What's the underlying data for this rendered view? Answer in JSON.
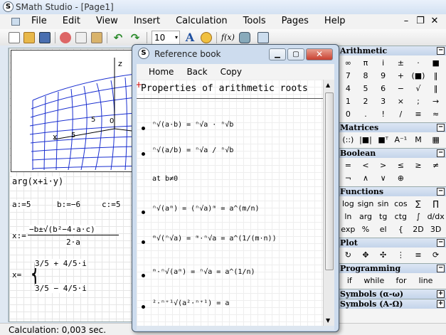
{
  "window": {
    "title": "SMath Studio - [Page1]"
  },
  "menu": [
    "File",
    "Edit",
    "View",
    "Insert",
    "Calculation",
    "Tools",
    "Pages",
    "Help"
  ],
  "toolbar": {
    "font_size": "10",
    "font_size_arrow": "▾",
    "text_icon": "A",
    "func_icon": "f(x)"
  },
  "worksheet": {
    "plot_axis_label_z": "z",
    "plot_axis_label_x": "x",
    "plot_tick_0": "0",
    "plot_tick_5": "5",
    "arg": "arg(x+i·y)",
    "assign_a": "a:=5",
    "assign_b": "b:=−6",
    "assign_c": "c:=5",
    "quad_lhs": "x:=",
    "quad_num": "−b±√(b²−4·a·c)",
    "quad_den": "2·a",
    "result_lhs": "x=",
    "result_1": "3/5 + 4/5·i",
    "result_2": "3/5 − 4/5·i"
  },
  "status": "Calculation: 0,003 sec.",
  "refbook": {
    "title": "Reference book",
    "menu": [
      "Home",
      "Back",
      "Copy"
    ],
    "heading": "Properties of arithmetic roots",
    "formulas": [
      "ⁿ√(a·b) = ⁿ√a · ⁿ√b",
      "ⁿ√(a/b) = ⁿ√a / ⁿ√b",
      "at    b≠0",
      "ⁿ√(aᵐ) = (ⁿ√a)ᵐ = a^(m/n)",
      "ᵐ√(ⁿ√a) = ᵐ·ⁿ√a = a^(1/(m·n))",
      "ᵐ·ⁿ√(aᵐ) = ⁿ√a = a^(1/n)",
      "²·ⁿ⁺¹√(a²·ⁿ⁺¹) = a"
    ]
  },
  "panel": {
    "arithmetic": {
      "title": "Arithmetic",
      "rows": [
        [
          "∞",
          "π",
          "i",
          "±",
          "·",
          "■"
        ],
        [
          "7",
          "8",
          "9",
          "+",
          "(■)",
          "‖"
        ],
        [
          "4",
          "5",
          "6",
          "−",
          "√",
          "‖"
        ],
        [
          "1",
          "2",
          "3",
          "×",
          ";",
          "→"
        ],
        [
          "0",
          ".",
          "!",
          "/",
          "≡",
          "≈"
        ]
      ]
    },
    "matrices": {
      "title": "Matrices",
      "items": [
        "(::)",
        "|■|",
        "■ᵀ",
        "A⁻¹",
        "M",
        "▦"
      ]
    },
    "boolean": {
      "title": "Boolean",
      "rows": [
        [
          "=",
          "<",
          ">",
          "≤",
          "≥",
          "≠"
        ],
        [
          "¬",
          "∧",
          "∨",
          "⊕"
        ]
      ]
    },
    "functions": {
      "title": "Functions",
      "rows": [
        [
          "log",
          "sign",
          "sin",
          "cos",
          "∑",
          "∏"
        ],
        [
          "ln",
          "arg",
          "tg",
          "ctg",
          "∫",
          "d/dx"
        ],
        [
          "exp",
          "%",
          "el",
          "{",
          "2D",
          "3D"
        ]
      ]
    },
    "plot": {
      "title": "Plot",
      "items": [
        "↻",
        "✥",
        "✣",
        "⋮",
        "≡",
        "⟳"
      ]
    },
    "programming": {
      "title": "Programming",
      "items": [
        "if",
        "while",
        "for",
        "line"
      ]
    },
    "symbols1": {
      "title": "Symbols (α-ω)"
    },
    "symbols2": {
      "title": "Symbols (Α-Ω)"
    }
  }
}
